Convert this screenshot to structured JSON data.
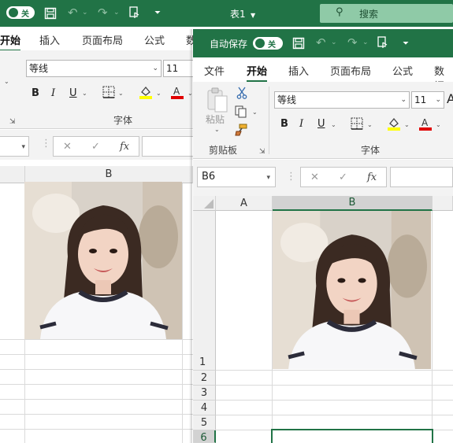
{
  "back_window": {
    "autosave_state": "关",
    "title": "表1",
    "search_placeholder": "搜索",
    "tabs": [
      "开始",
      "插入",
      "页面布局",
      "公式",
      "数"
    ],
    "font_name": "等线",
    "font_size": "11",
    "font_group_label": "字体",
    "column_b": "B"
  },
  "front_window": {
    "autosave_label": "自动保存",
    "autosave_state": "关",
    "tabs": [
      "文件",
      "开始",
      "插入",
      "页面布局",
      "公式",
      "数据"
    ],
    "clipboard_paste": "粘贴",
    "clipboard_group_label": "剪贴板",
    "font_name": "等线",
    "font_size": "11",
    "font_group_label": "字体",
    "name_box": "B6",
    "fx_label": "fx",
    "columns": [
      "A",
      "B"
    ],
    "rows": [
      "1",
      "2",
      "3",
      "4",
      "5",
      "6"
    ]
  },
  "colors": {
    "accent": "#217346",
    "ribbon_bg": "#f3f3f3",
    "header_bg": "#f0f0f0"
  },
  "icons": [
    "toggle-icon",
    "save-icon",
    "undo-icon",
    "redo-icon",
    "touch-mode-icon",
    "customize-icon",
    "search-icon",
    "paste-icon",
    "cut-icon",
    "copy-icon",
    "format-painter-icon",
    "bold-icon",
    "italic-icon",
    "underline-icon",
    "border-icon",
    "fill-color-icon",
    "font-color-icon",
    "cancel-icon",
    "confirm-icon",
    "fx-icon"
  ]
}
